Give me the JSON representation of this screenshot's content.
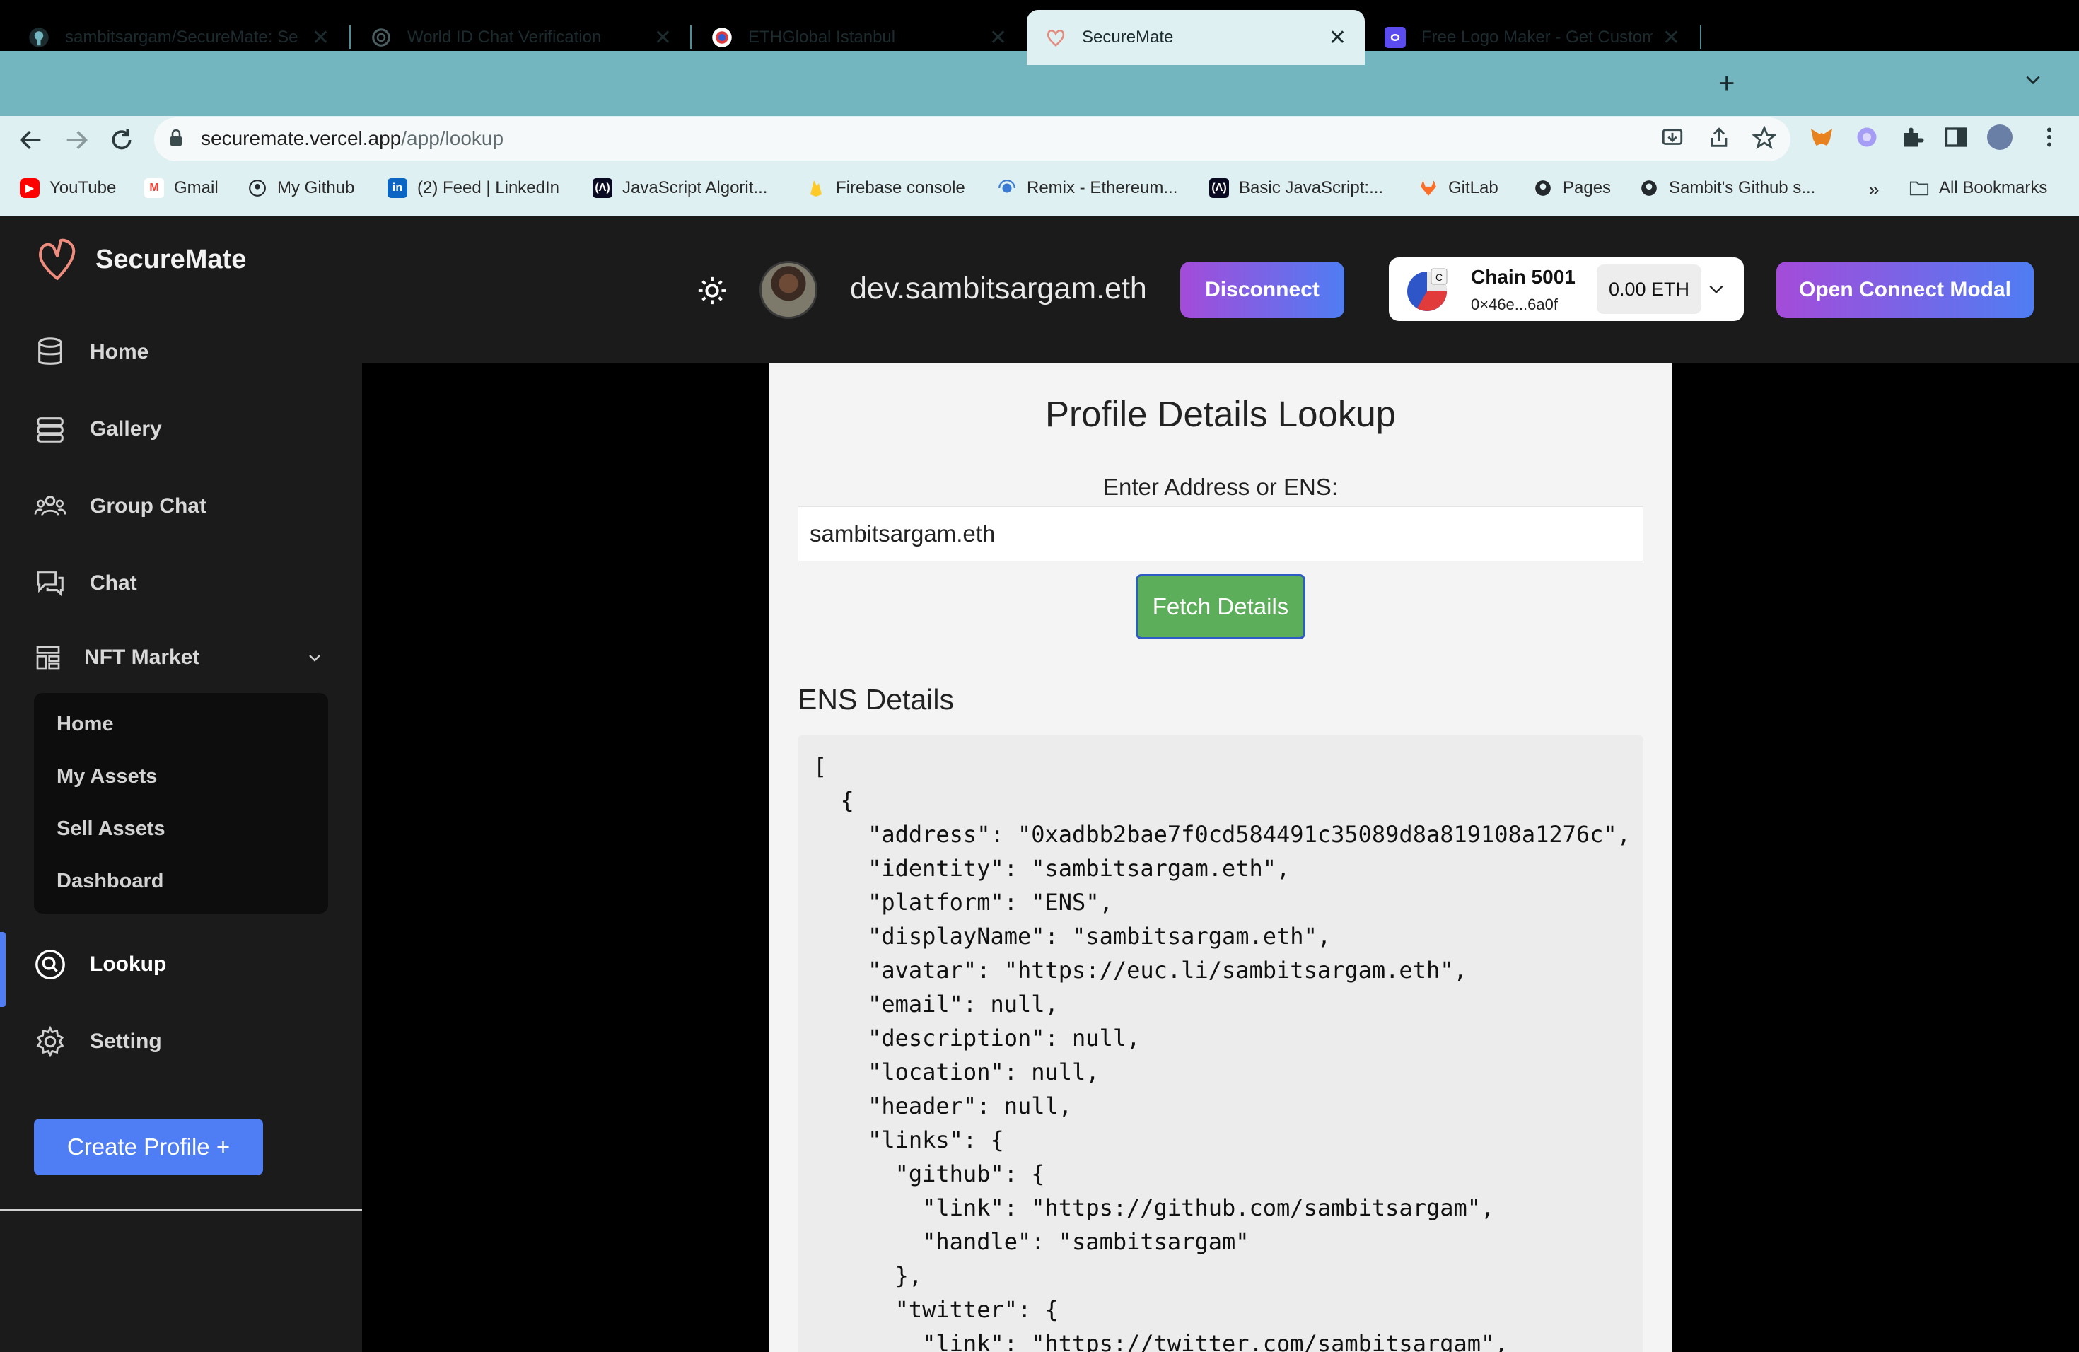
{
  "browser": {
    "tabs": [
      {
        "label": "sambitsargam/SecureMate: Se",
        "favicon": "github-icon",
        "active": false
      },
      {
        "label": "World ID Chat Verification",
        "favicon": "openai-icon",
        "active": false
      },
      {
        "label": "ETHGlobal Istanbul",
        "favicon": "ethglobal-icon",
        "active": false
      },
      {
        "label": "SecureMate",
        "favicon": "heart-icon",
        "active": true
      },
      {
        "label": "Free Logo Maker - Get Custom",
        "favicon": "logo-maker-icon",
        "active": false
      }
    ],
    "close_glyph": "✕",
    "newtab_glyph": "+",
    "url": {
      "host": "securemate.vercel.app",
      "path": "/app/lookup"
    },
    "bookmarks": [
      {
        "label": "YouTube",
        "icon": "youtube-icon",
        "color": "#ff0000"
      },
      {
        "label": "Gmail",
        "icon": "gmail-icon",
        "color": "#ea4335"
      },
      {
        "label": "My Github",
        "icon": "github-icon",
        "color": "#24292e"
      },
      {
        "label": "(2) Feed | LinkedIn",
        "icon": "linkedin-icon",
        "color": "#0a66c2"
      },
      {
        "label": "JavaScript Algorit...",
        "icon": "fcc-icon",
        "color": "#0a0a23"
      },
      {
        "label": "Firebase console",
        "icon": "firebase-icon",
        "color": "#ffca28"
      },
      {
        "label": "Remix - Ethereum...",
        "icon": "remix-icon",
        "color": "#3a7bd5"
      },
      {
        "label": "Basic JavaScript:...",
        "icon": "fcc-icon",
        "color": "#0a0a23"
      },
      {
        "label": "GitLab",
        "icon": "gitlab-icon",
        "color": "#fc6d26"
      },
      {
        "label": "Pages",
        "icon": "github-icon",
        "color": "#24292e"
      },
      {
        "label": "Sambit's Github s...",
        "icon": "github-icon",
        "color": "#24292e"
      }
    ],
    "more_bookmarks": "»",
    "all_bookmarks": "All Bookmarks"
  },
  "sidebar": {
    "brand": "SecureMate",
    "items": [
      {
        "label": "Home",
        "icon": "database-icon"
      },
      {
        "label": "Gallery",
        "icon": "layers-icon"
      },
      {
        "label": "Group Chat",
        "icon": "users-icon"
      },
      {
        "label": "Chat",
        "icon": "chat-icon"
      },
      {
        "label": "NFT Market",
        "icon": "market-icon"
      },
      {
        "label": "Lookup",
        "icon": "search-icon"
      },
      {
        "label": "Setting",
        "icon": "gear-icon"
      }
    ],
    "nft_submenu": [
      "Home",
      "My Assets",
      "Sell Assets",
      "Dashboard"
    ],
    "create_profile": "Create Profile  +"
  },
  "header": {
    "ens_name": "dev.sambitsargam.eth",
    "disconnect": "Disconnect",
    "chain_name": "Chain 5001",
    "chain_address": "0×46e...6a0f",
    "chain_badge": "C",
    "balance": "0.00 ETH",
    "open_connect": "Open Connect Modal"
  },
  "lookup": {
    "title": "Profile Details Lookup",
    "input_label": "Enter Address or ENS:",
    "input_value": "sambitsargam.eth",
    "fetch_button": "Fetch Details",
    "ens_heading": "ENS Details",
    "json_lines": [
      "[",
      "  {",
      "    \"address\": \"0xadbb2bae7f0cd584491c35089d8a819108a1276c\",",
      "    \"identity\": \"sambitsargam.eth\",",
      "    \"platform\": \"ENS\",",
      "    \"displayName\": \"sambitsargam.eth\",",
      "    \"avatar\": \"https://euc.li/sambitsargam.eth\",",
      "    \"email\": null,",
      "    \"description\": null,",
      "    \"location\": null,",
      "    \"header\": null,",
      "    \"links\": {",
      "      \"github\": {",
      "        \"link\": \"https://github.com/sambitsargam\",",
      "        \"handle\": \"sambitsargam\"",
      "      },",
      "      \"twitter\": {",
      "        \"link\": \"https://twitter.com/sambitsargam\","
    ]
  },
  "colors": {
    "accent": "#4f7df3",
    "gradient_start": "#a44bd9",
    "fetch_green": "#5cae5a",
    "tabstrip": "#74b6bf"
  }
}
